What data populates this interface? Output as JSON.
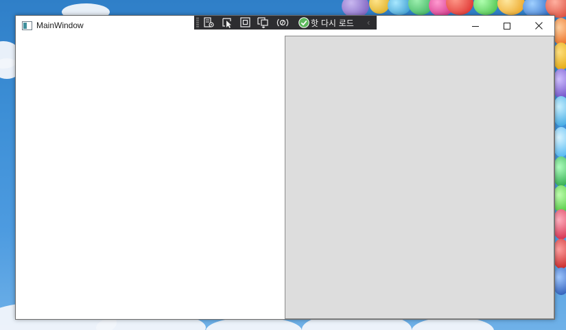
{
  "window": {
    "title": "MainWindow",
    "controls": {
      "minimize": "—",
      "maximize": "☐",
      "close": "✕"
    }
  },
  "debug_toolbar": {
    "hot_reload_label": "핫 다시 로드",
    "collapse_glyph": "‹",
    "icons": [
      "live-visual-tree-icon",
      "select-element-icon",
      "display-adorners-icon",
      "track-focus-icon",
      "binding-failures-icon",
      "hot-reload-check-icon"
    ]
  },
  "colors": {
    "toolbar_bg": "#2d2d30",
    "right_panel_bg": "#dddddd",
    "window_bg": "#ffffff",
    "check_green": "#5cb85c"
  }
}
